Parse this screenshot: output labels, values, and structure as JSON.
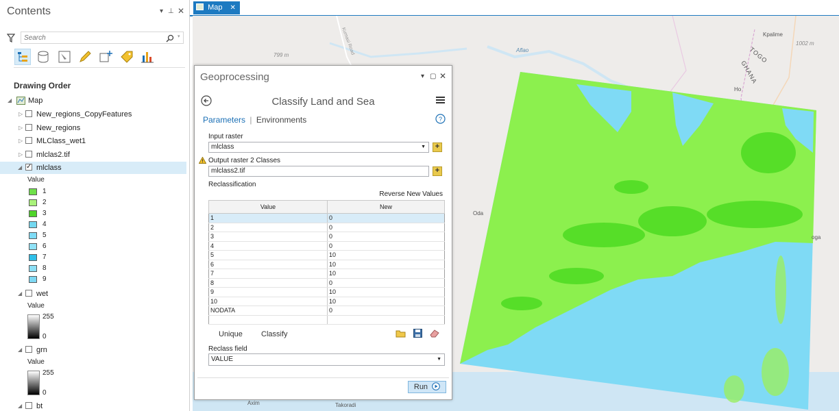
{
  "contents": {
    "title": "Contents",
    "search_placeholder": "Search",
    "drawing_order": "Drawing Order",
    "map_label": "Map",
    "layers": [
      {
        "name": "New_regions_CopyFeatures"
      },
      {
        "name": "New_regions"
      },
      {
        "name": "MLClass_wet1"
      },
      {
        "name": "mlclas2.tif"
      },
      {
        "name": "mlclass"
      }
    ],
    "mlclass_legend_title": "Value",
    "legend": [
      {
        "label": "1",
        "color": "#6fe04a"
      },
      {
        "label": "2",
        "color": "#a9f27a"
      },
      {
        "label": "3",
        "color": "#4fd42a"
      },
      {
        "label": "4",
        "color": "#74d8f0"
      },
      {
        "label": "5",
        "color": "#7fdcf6"
      },
      {
        "label": "6",
        "color": "#8fe2f7"
      },
      {
        "label": "7",
        "color": "#2fbfe8"
      },
      {
        "label": "8",
        "color": "#8cdff5"
      },
      {
        "label": "9",
        "color": "#7ed8f3"
      }
    ],
    "wet": {
      "name": "wet",
      "legend_title": "Value",
      "max": "255",
      "min": "0"
    },
    "grn": {
      "name": "grn",
      "legend_title": "Value",
      "max": "255",
      "min": "0"
    },
    "bt": {
      "name": "bt"
    }
  },
  "map": {
    "tab_label": "Map",
    "labels": {
      "aflao": "Aflao",
      "kpalime": "Kpalime",
      "togo": "TOGO",
      "ghana": "GHANA",
      "ho": "Ho",
      "oda": "Oda",
      "koga": "oga",
      "axim": "Axim",
      "takoradi": "Takoradi",
      "elev1": "799 m",
      "elev2": "1002 m",
      "road": "Kumasi Road"
    },
    "colors": {
      "land": "#8cf04e",
      "sea": "#7fdaf5",
      "base": "#eeecea",
      "water": "#cfe6f4"
    }
  },
  "geoprocessing": {
    "header": "Geoprocessing",
    "tool_name": "Classify Land and Sea",
    "tab_parameters": "Parameters",
    "tab_separator": "|",
    "tab_environments": "Environments",
    "input_raster_label": "Input raster",
    "input_raster_value": "mlclass",
    "output_raster_label": "Output raster 2 Classes",
    "output_raster_value": "mlclass2.tif",
    "reclass_label": "Reclassification",
    "reverse_label": "Reverse New Values",
    "table_headers": [
      "Value",
      "New"
    ],
    "rows": [
      [
        "1",
        "0"
      ],
      [
        "2",
        "0"
      ],
      [
        "3",
        "0"
      ],
      [
        "4",
        "0"
      ],
      [
        "5",
        "10"
      ],
      [
        "6",
        "10"
      ],
      [
        "7",
        "10"
      ],
      [
        "8",
        "0"
      ],
      [
        "9",
        "10"
      ],
      [
        "10",
        "10"
      ],
      [
        "NODATA",
        "0"
      ]
    ],
    "unique_label": "Unique",
    "classify_label": "Classify",
    "reclass_field_label": "Reclass field",
    "reclass_field_value": "VALUE",
    "run_label": "Run"
  }
}
